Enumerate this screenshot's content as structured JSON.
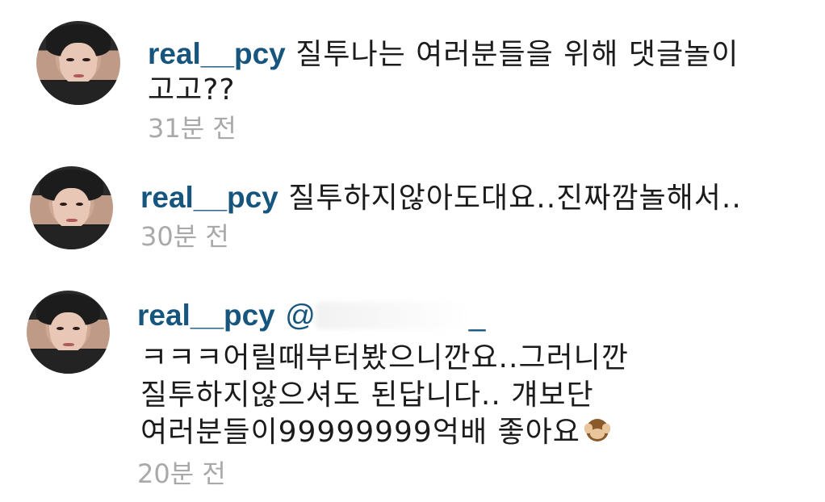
{
  "comments": [
    {
      "username": "real__pcy",
      "text_line1": "질투나는 여러분들을 위해 댓글놀이",
      "text_line2": "고고??",
      "time": "31분 전"
    },
    {
      "username": "real__pcy",
      "text_line1": "질투하지않아도대요..진짜깜놀해서..",
      "time": "30분 전"
    },
    {
      "username": "real__pcy",
      "mention_visible": "@",
      "mention_trailing": "_",
      "text_line1": "ㅋㅋㅋ어릴때부터봤으니깐요..그러니깐",
      "text_line2": "질투하지않으셔도 된답니다.. 걔보단",
      "text_line3": "여러분들이99999999억배 좋아요",
      "emoji": "see-no-evil-monkey",
      "time": "20분 전"
    }
  ]
}
